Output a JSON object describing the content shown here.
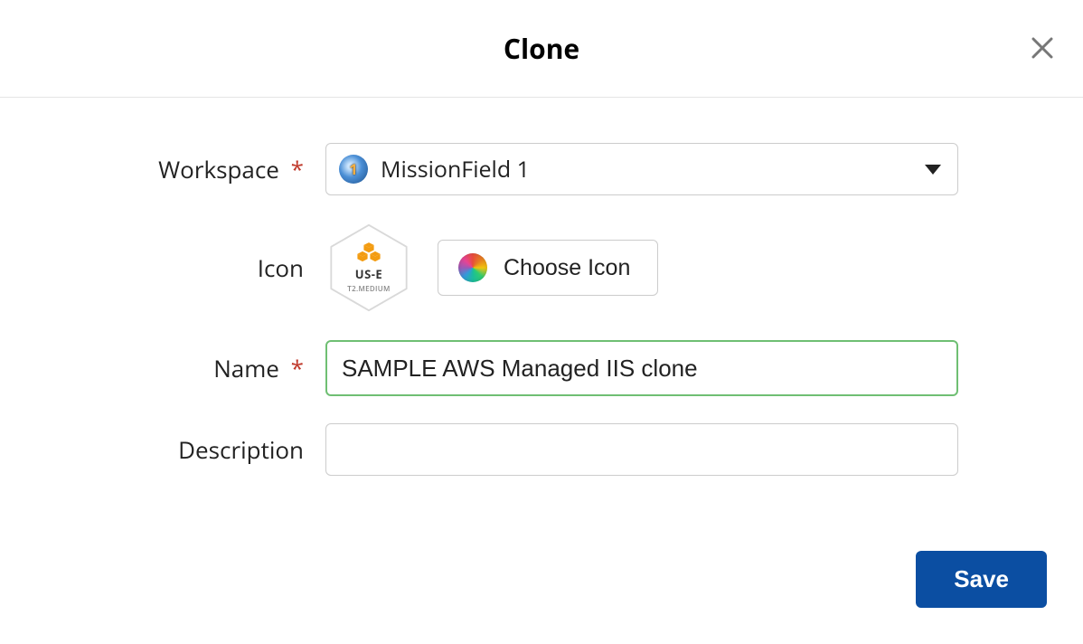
{
  "header": {
    "title": "Clone"
  },
  "form": {
    "workspace": {
      "label": "Workspace",
      "required": "*",
      "selected": "MissionField 1"
    },
    "icon": {
      "label": "Icon",
      "preview_line1": "US-E",
      "preview_line2": "T2.MEDIUM",
      "choose_button": "Choose Icon"
    },
    "name": {
      "label": "Name",
      "required": "*",
      "value": "SAMPLE AWS Managed IIS clone"
    },
    "description": {
      "label": "Description",
      "value": ""
    }
  },
  "footer": {
    "save": "Save"
  }
}
